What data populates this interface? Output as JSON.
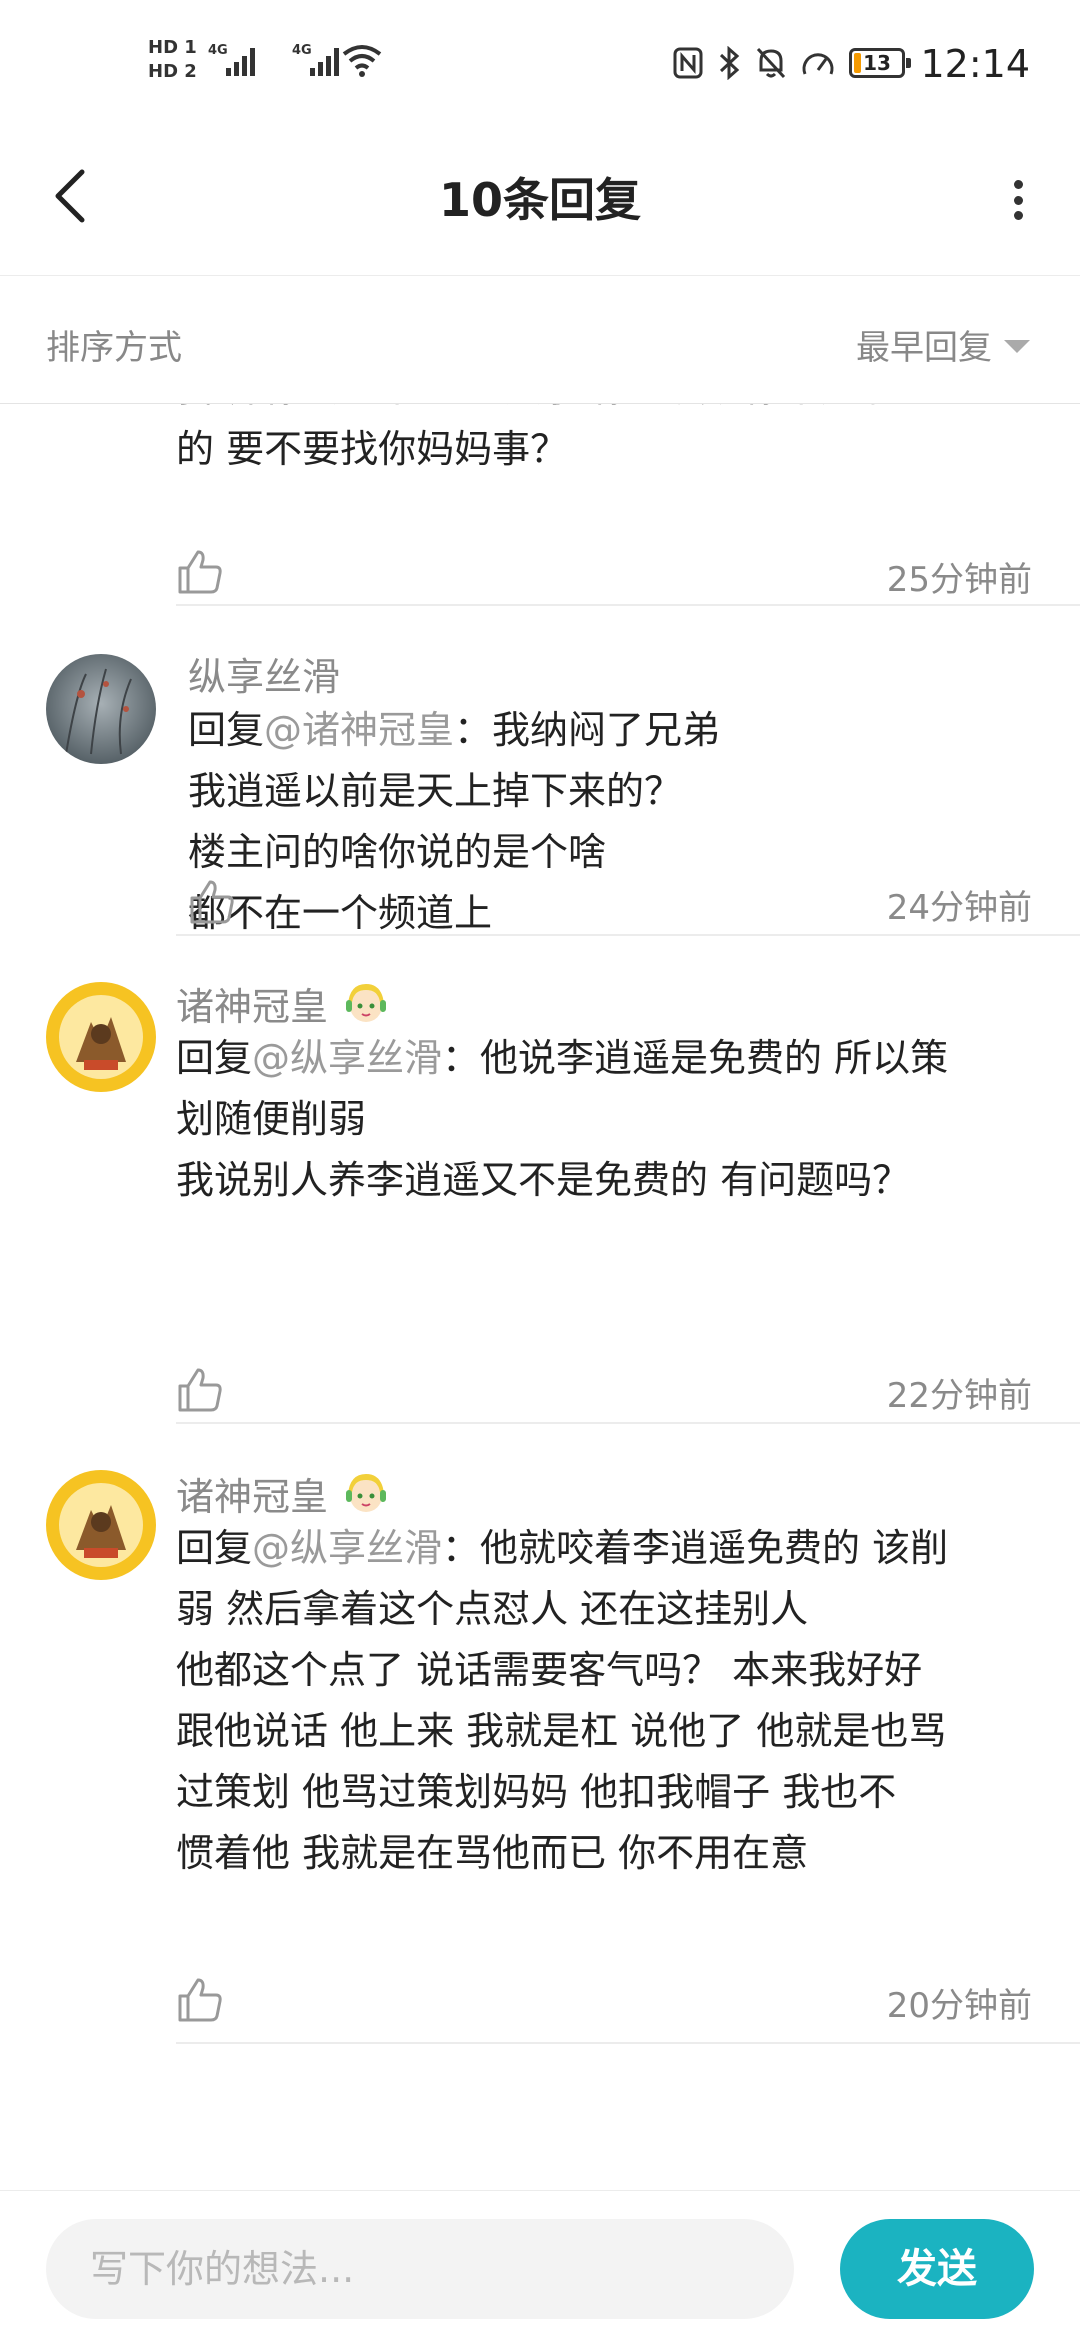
{
  "status_bar": {
    "hd1": "HD 1",
    "hd2": "HD 2",
    "net1": "4G",
    "net2": "4G",
    "battery": "13",
    "time": "12:14"
  },
  "header": {
    "title": "10条回复"
  },
  "sort": {
    "label": "排序方式",
    "value": "最早回复"
  },
  "comments": [
    {
      "lines": [
        "我 养你要钱不？  长大了 你爸发现你不是亲生",
        "的  要不要找你妈妈事？"
      ],
      "time": "25分钟前"
    },
    {
      "name": "纵享丝滑",
      "reply_prefix": "回复",
      "reply_to": "@诸神冠皇",
      "reply_sep": "：",
      "lines": [
        "我纳闷了兄弟",
        "我逍遥以前是天上掉下来的？",
        "楼主问的啥你说的是个啥",
        "都不在一个频道上"
      ],
      "time": "24分钟前"
    },
    {
      "name": "诸神冠皇",
      "reply_prefix": "回复",
      "reply_to": "@纵享丝滑",
      "reply_sep": "：",
      "lines": [
        "他说李逍遥是免费的 所以策",
        "划随便削弱",
        "我说别人养李逍遥又不是免费的 有问题吗？"
      ],
      "time": "22分钟前"
    },
    {
      "name": "诸神冠皇",
      "reply_prefix": "回复",
      "reply_to": "@纵享丝滑",
      "reply_sep": "：",
      "lines": [
        "他就咬着李逍遥免费的 该削",
        "弱  然后拿着这个点怼人  还在这挂别人",
        "他都这个点了 说话需要客气吗？   本来我好好",
        "跟他说话 他上来 我就是杠  说他了 他就是也骂",
        "过策划  他骂过策划妈妈  他扣我帽子  我也不",
        "惯着他  我就是在骂他而已  你不用在意"
      ],
      "time": "20分钟前"
    }
  ],
  "input": {
    "placeholder": "写下你的想法..."
  },
  "send_label": "发送",
  "colors": {
    "accent": "#1bb3c1",
    "muted": "#8a8a8a",
    "battery": "#f59a00"
  },
  "icons": [
    "back-icon",
    "more-icon",
    "dropdown-icon",
    "like-icon",
    "wifi-icon",
    "nfc-icon",
    "bluetooth-icon",
    "mute-icon",
    "speed-icon"
  ]
}
